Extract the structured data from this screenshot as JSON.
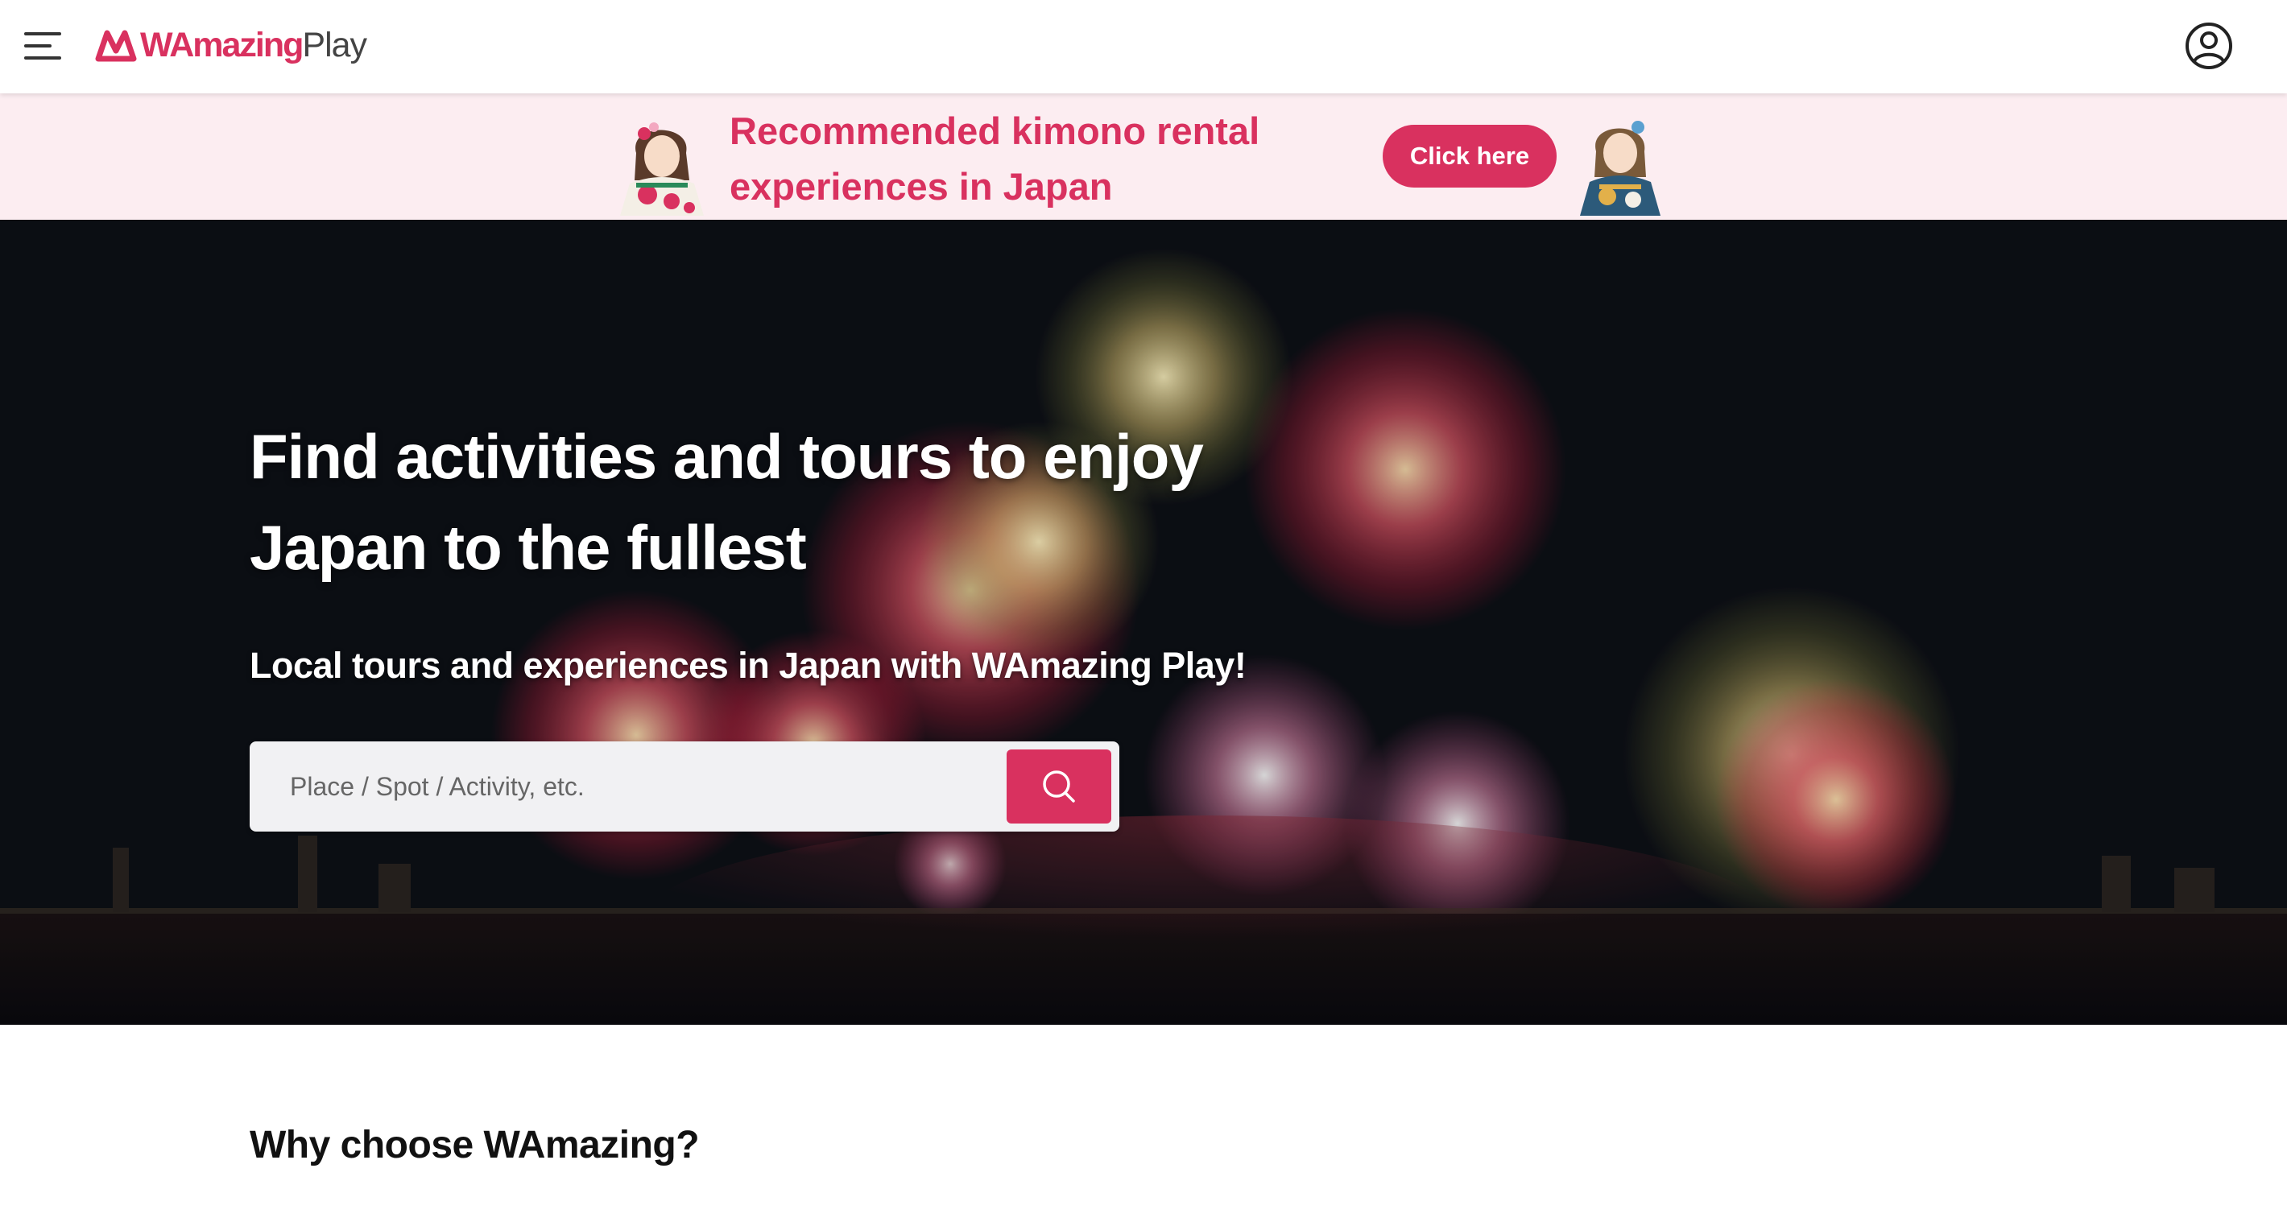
{
  "header": {
    "menu_icon": "hamburger-menu-icon",
    "logo": {
      "part1": "WAmazing",
      "part2": "Play"
    },
    "account_icon": "user-circle-icon"
  },
  "promo": {
    "text": "Recommended kimono rental experiences in Japan",
    "button_label": "Click here"
  },
  "hero": {
    "title_line1": "Find activities and tours to enjoy",
    "title_line2": "Japan to the fullest",
    "subtitle": "Local tours and experiences in Japan with WAmazing Play!",
    "search": {
      "placeholder": "Place / Spot / Activity, etc.",
      "value": "",
      "icon": "search-icon"
    }
  },
  "section": {
    "title": "Why choose WAmazing?"
  },
  "colors": {
    "brand": "#d9315f",
    "promo_bg": "#fcedf1",
    "hero_bg": "#0d1016"
  }
}
